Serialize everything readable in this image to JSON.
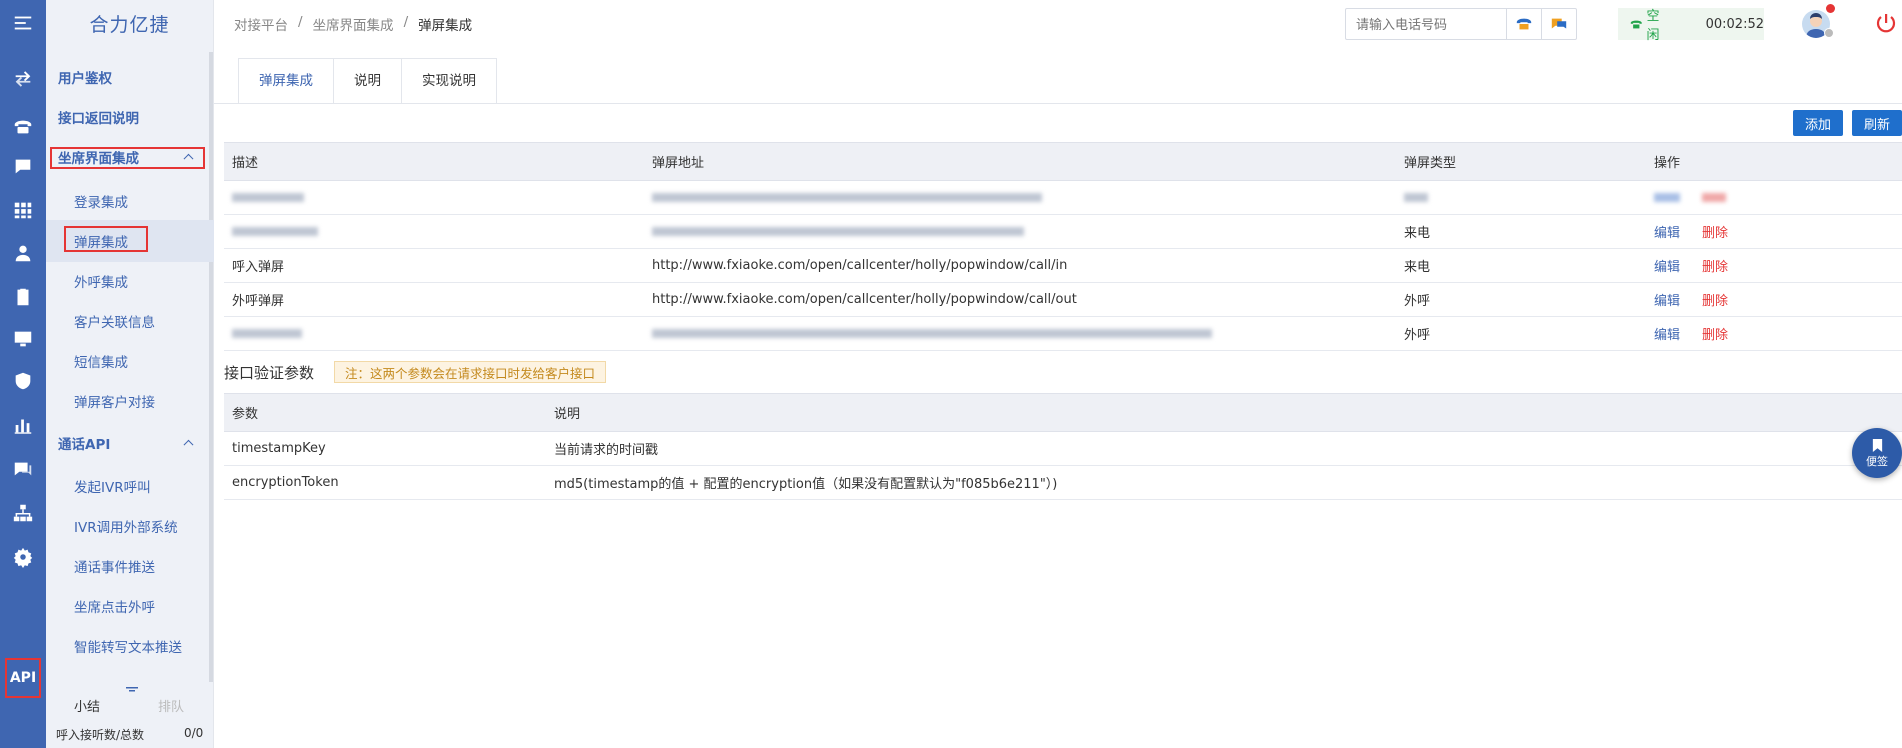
{
  "app": {
    "brand": "合力亿捷"
  },
  "rail": {
    "api_label": "API"
  },
  "sidebar": {
    "items": [
      {
        "label": "用户鉴权",
        "type": "header"
      },
      {
        "label": "接口返回说明",
        "type": "header"
      },
      {
        "label": "坐席界面集成",
        "type": "header",
        "expanded": true
      },
      {
        "label": "登录集成",
        "type": "sub"
      },
      {
        "label": "弹屏集成",
        "type": "sub",
        "selected": true
      },
      {
        "label": "外呼集成",
        "type": "sub"
      },
      {
        "label": "客户关联信息",
        "type": "sub"
      },
      {
        "label": "短信集成",
        "type": "sub"
      },
      {
        "label": "弹屏客户对接",
        "type": "sub"
      },
      {
        "label": "通话API",
        "type": "header",
        "expanded": true
      },
      {
        "label": "发起IVR呼叫",
        "type": "sub"
      },
      {
        "label": "IVR调用外部系统",
        "type": "sub"
      },
      {
        "label": "通话事件推送",
        "type": "sub"
      },
      {
        "label": "坐席点击外呼",
        "type": "sub"
      },
      {
        "label": "智能转写文本推送",
        "type": "sub"
      }
    ],
    "footer": {
      "summary_label": "小结",
      "queue_label": "排队",
      "incoming_label": "呼入接听数/总数",
      "incoming_value": "0/0"
    }
  },
  "breadcrumb": {
    "items": [
      "对接平台",
      "坐席界面集成",
      "弹屏集成"
    ],
    "separator": "/"
  },
  "phone": {
    "placeholder": "请输入电话号码"
  },
  "status": {
    "label": "空闲",
    "timer": "00:02:52"
  },
  "tabs": [
    {
      "label": "弹屏集成",
      "active": true
    },
    {
      "label": "说明"
    },
    {
      "label": "实现说明"
    }
  ],
  "actions": {
    "add": "添加",
    "refresh": "刷新"
  },
  "popup_table": {
    "headers": [
      "描述",
      "弹屏地址",
      "弹屏类型",
      "操作"
    ],
    "rows": [
      {
        "desc": "",
        "url": "",
        "type": "",
        "blurred": true,
        "edit": "编辑",
        "delete": "删除"
      },
      {
        "desc": "",
        "url": "",
        "type": "来电",
        "blurred": true,
        "edit": "编辑",
        "delete": "删除"
      },
      {
        "desc": "呼入弹屏",
        "url": "http://www.fxiaoke.com/open/callcenter/holly/popwindow/call/in",
        "type": "来电",
        "edit": "编辑",
        "delete": "删除"
      },
      {
        "desc": "外呼弹屏",
        "url": "http://www.fxiaoke.com/open/callcenter/holly/popwindow/call/out",
        "type": "外呼",
        "edit": "编辑",
        "delete": "删除"
      },
      {
        "desc": "",
        "url": "",
        "type": "外呼",
        "blurred": true,
        "edit": "编辑",
        "delete": "删除"
      }
    ]
  },
  "params": {
    "title": "接口验证参数",
    "note": "注：这两个参数会在请求接口时发给客户接口",
    "headers": [
      "参数",
      "说明"
    ],
    "rows": [
      {
        "name": "timestampKey",
        "desc": "当前请求的时间戳"
      },
      {
        "name": "encryptionToken",
        "desc": "md5(timestamp的值 + 配置的encryption值（如果没有配置默认为\"f085b6e211\"）)"
      }
    ]
  },
  "memo": {
    "label": "便签"
  }
}
